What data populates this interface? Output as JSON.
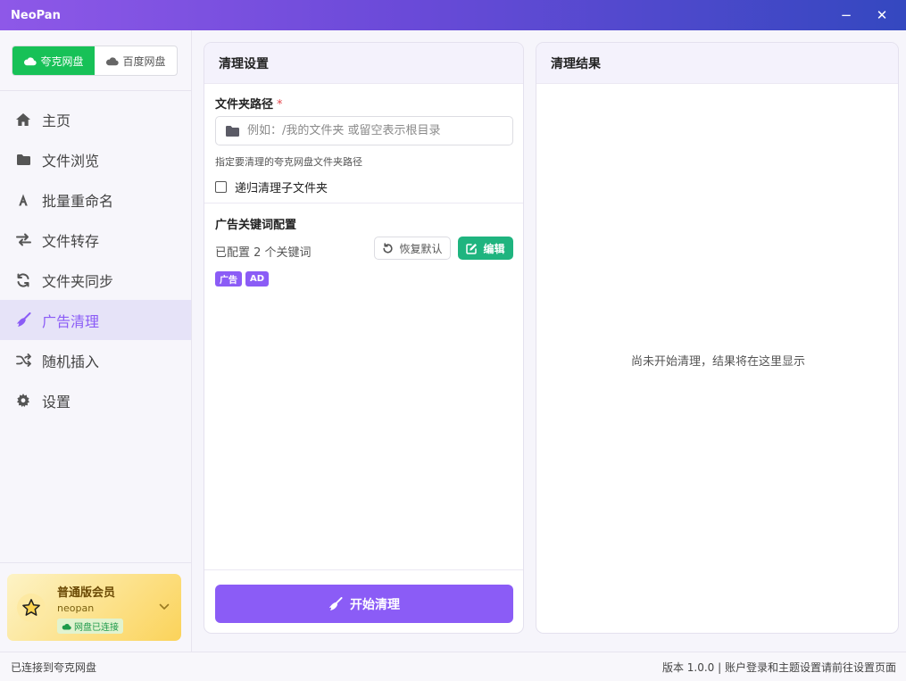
{
  "window": {
    "title": "NeoPan",
    "minimize_glyph": "−",
    "close_glyph": "✕"
  },
  "sidebar": {
    "providers": [
      {
        "label": "夸克网盘",
        "active": true,
        "icon": "cloud-icon"
      },
      {
        "label": "百度网盘",
        "active": false,
        "icon": "cloud-icon"
      }
    ],
    "nav": [
      {
        "label": "主页",
        "icon": "home-icon"
      },
      {
        "label": "文件浏览",
        "icon": "folder-icon"
      },
      {
        "label": "批量重命名",
        "icon": "font-icon"
      },
      {
        "label": "文件转存",
        "icon": "transfer-icon"
      },
      {
        "label": "文件夹同步",
        "icon": "sync-icon"
      },
      {
        "label": "广告清理",
        "icon": "broom-icon",
        "active": true
      },
      {
        "label": "随机插入",
        "icon": "shuffle-icon"
      },
      {
        "label": "设置",
        "icon": "gear-icon"
      }
    ],
    "member": {
      "title": "普通版会员",
      "username": "neopan",
      "badge": "网盘已连接"
    }
  },
  "settings_panel": {
    "title": "清理设置",
    "folder_label": "文件夹路径",
    "required_mark": "*",
    "folder_placeholder": "例如：/我的文件夹 或留空表示根目录",
    "folder_value": "",
    "folder_hint": "指定要清理的夸克网盘文件夹路径",
    "recursive_label": "递归清理子文件夹",
    "recursive_checked": false,
    "keywords_title": "广告关键词配置",
    "keywords_count": "已配置 2 个关键词",
    "reset_label": "恢复默认",
    "edit_label": "编辑",
    "keywords": [
      "广告",
      "AD"
    ],
    "start_label": "开始清理"
  },
  "results_panel": {
    "title": "清理结果",
    "empty_message": "尚未开始清理，结果将在这里显示"
  },
  "statusbar": {
    "left": "已连接到夸克网盘",
    "right": "版本 1.0.0 | 账户登录和主题设置请前往设置页面"
  },
  "colors": {
    "accent": "#8b5cf6",
    "quark_green": "#17c157",
    "edit_green": "#1fb47f",
    "title_gradient_start": "#8e58e8",
    "title_gradient_end": "#3448c0"
  }
}
